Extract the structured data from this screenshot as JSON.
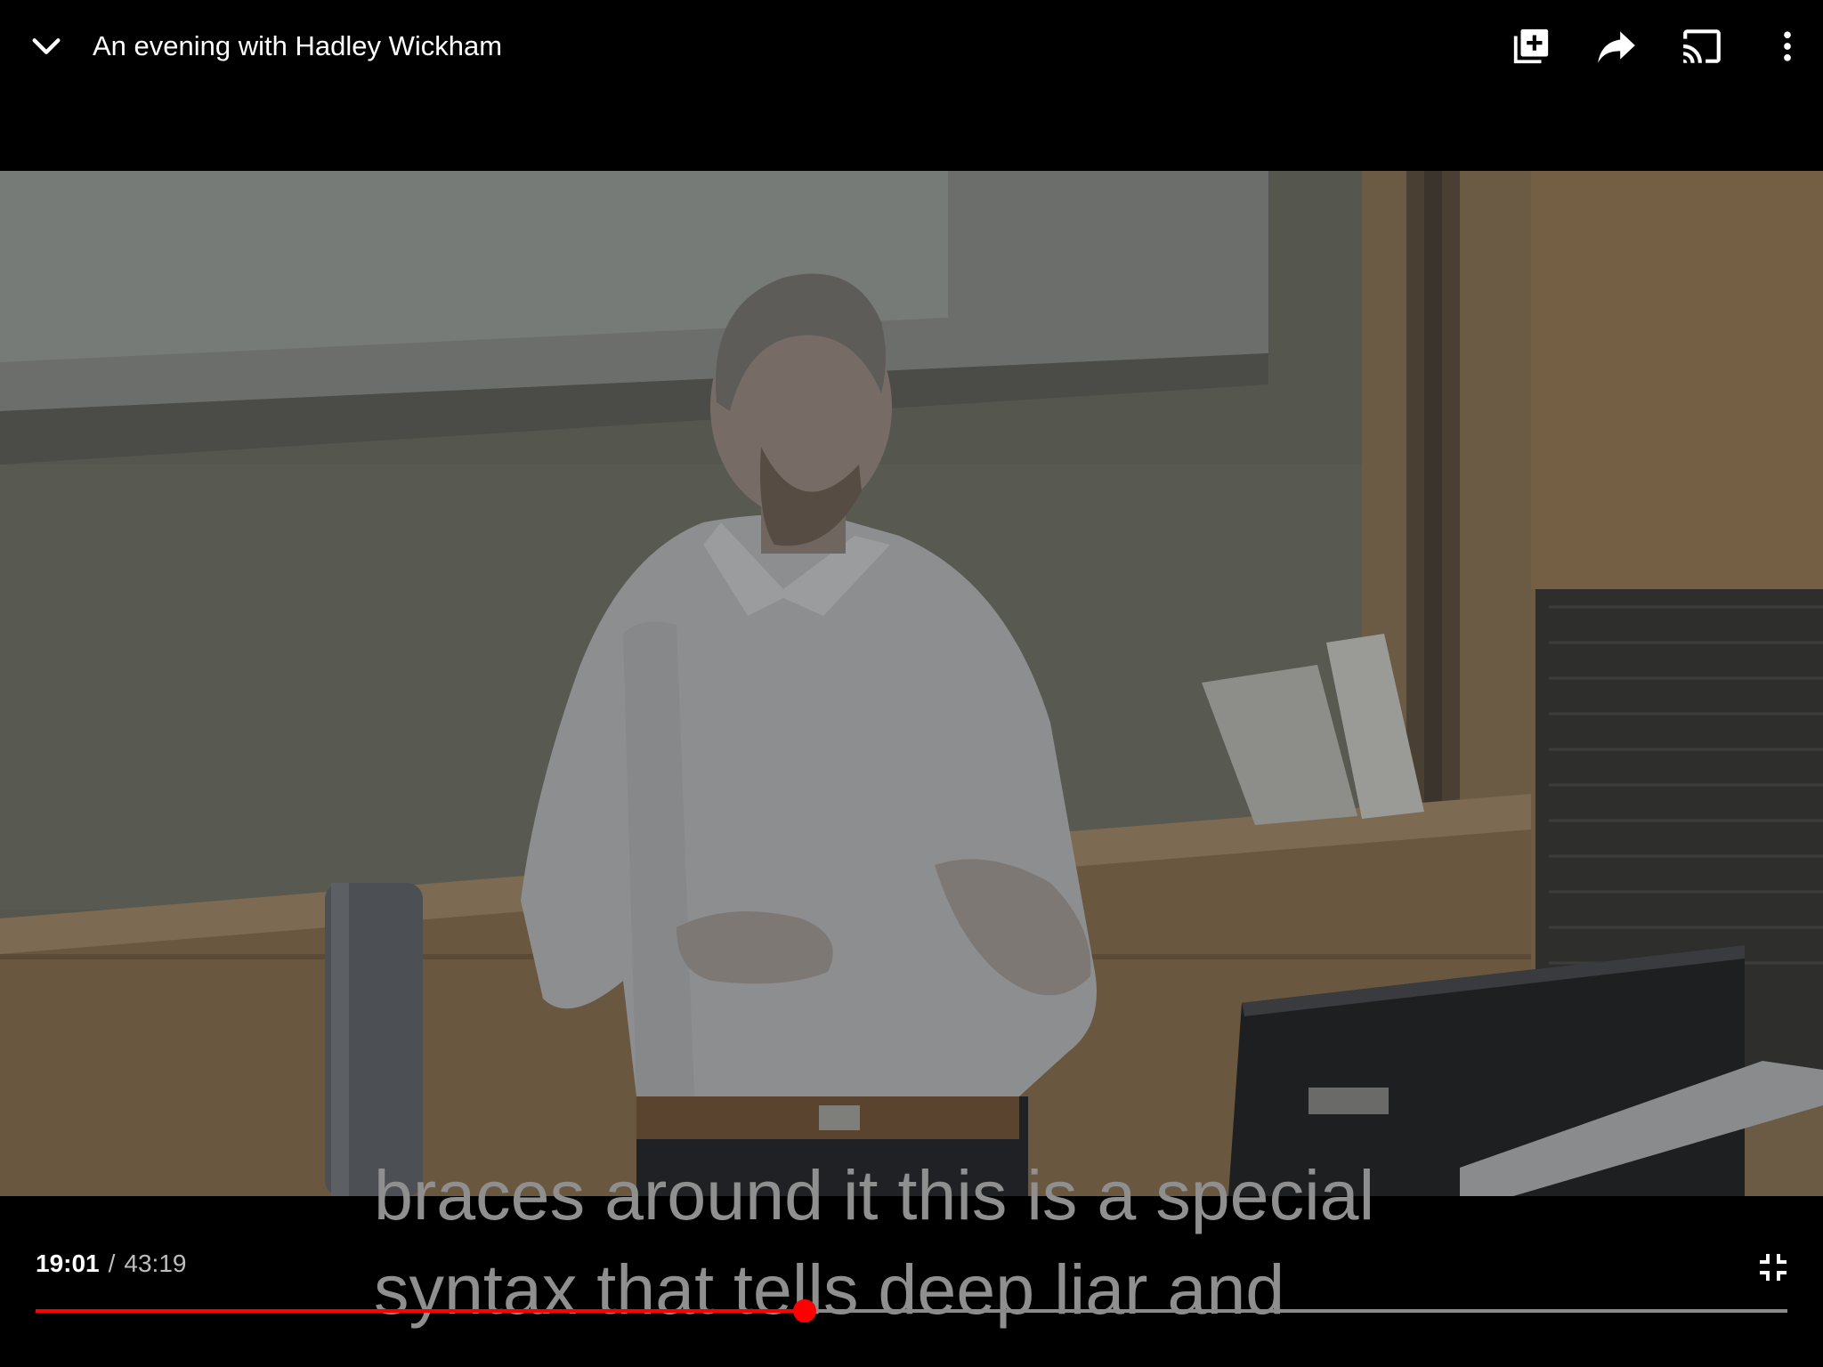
{
  "video": {
    "title": "An evening with Hadley Wickham",
    "current_time": "19:01",
    "separator": "/",
    "total_time": "43:19",
    "progress": 0.4391
  },
  "captions": {
    "line1": "braces around it this is a special",
    "line2": "syntax that tells deep liar and"
  },
  "icons": {
    "collapse": "chevron-down-icon",
    "add": "add-to-playlist-icon",
    "share": "share-arrow-icon",
    "cast": "cast-icon",
    "more": "more-vertical-icon",
    "exit_fullscreen": "exit-fullscreen-icon"
  },
  "colors": {
    "progress_played": "#ff0000",
    "progress_track": "#8a8a8a",
    "caption_text": "#8f8f8f"
  }
}
